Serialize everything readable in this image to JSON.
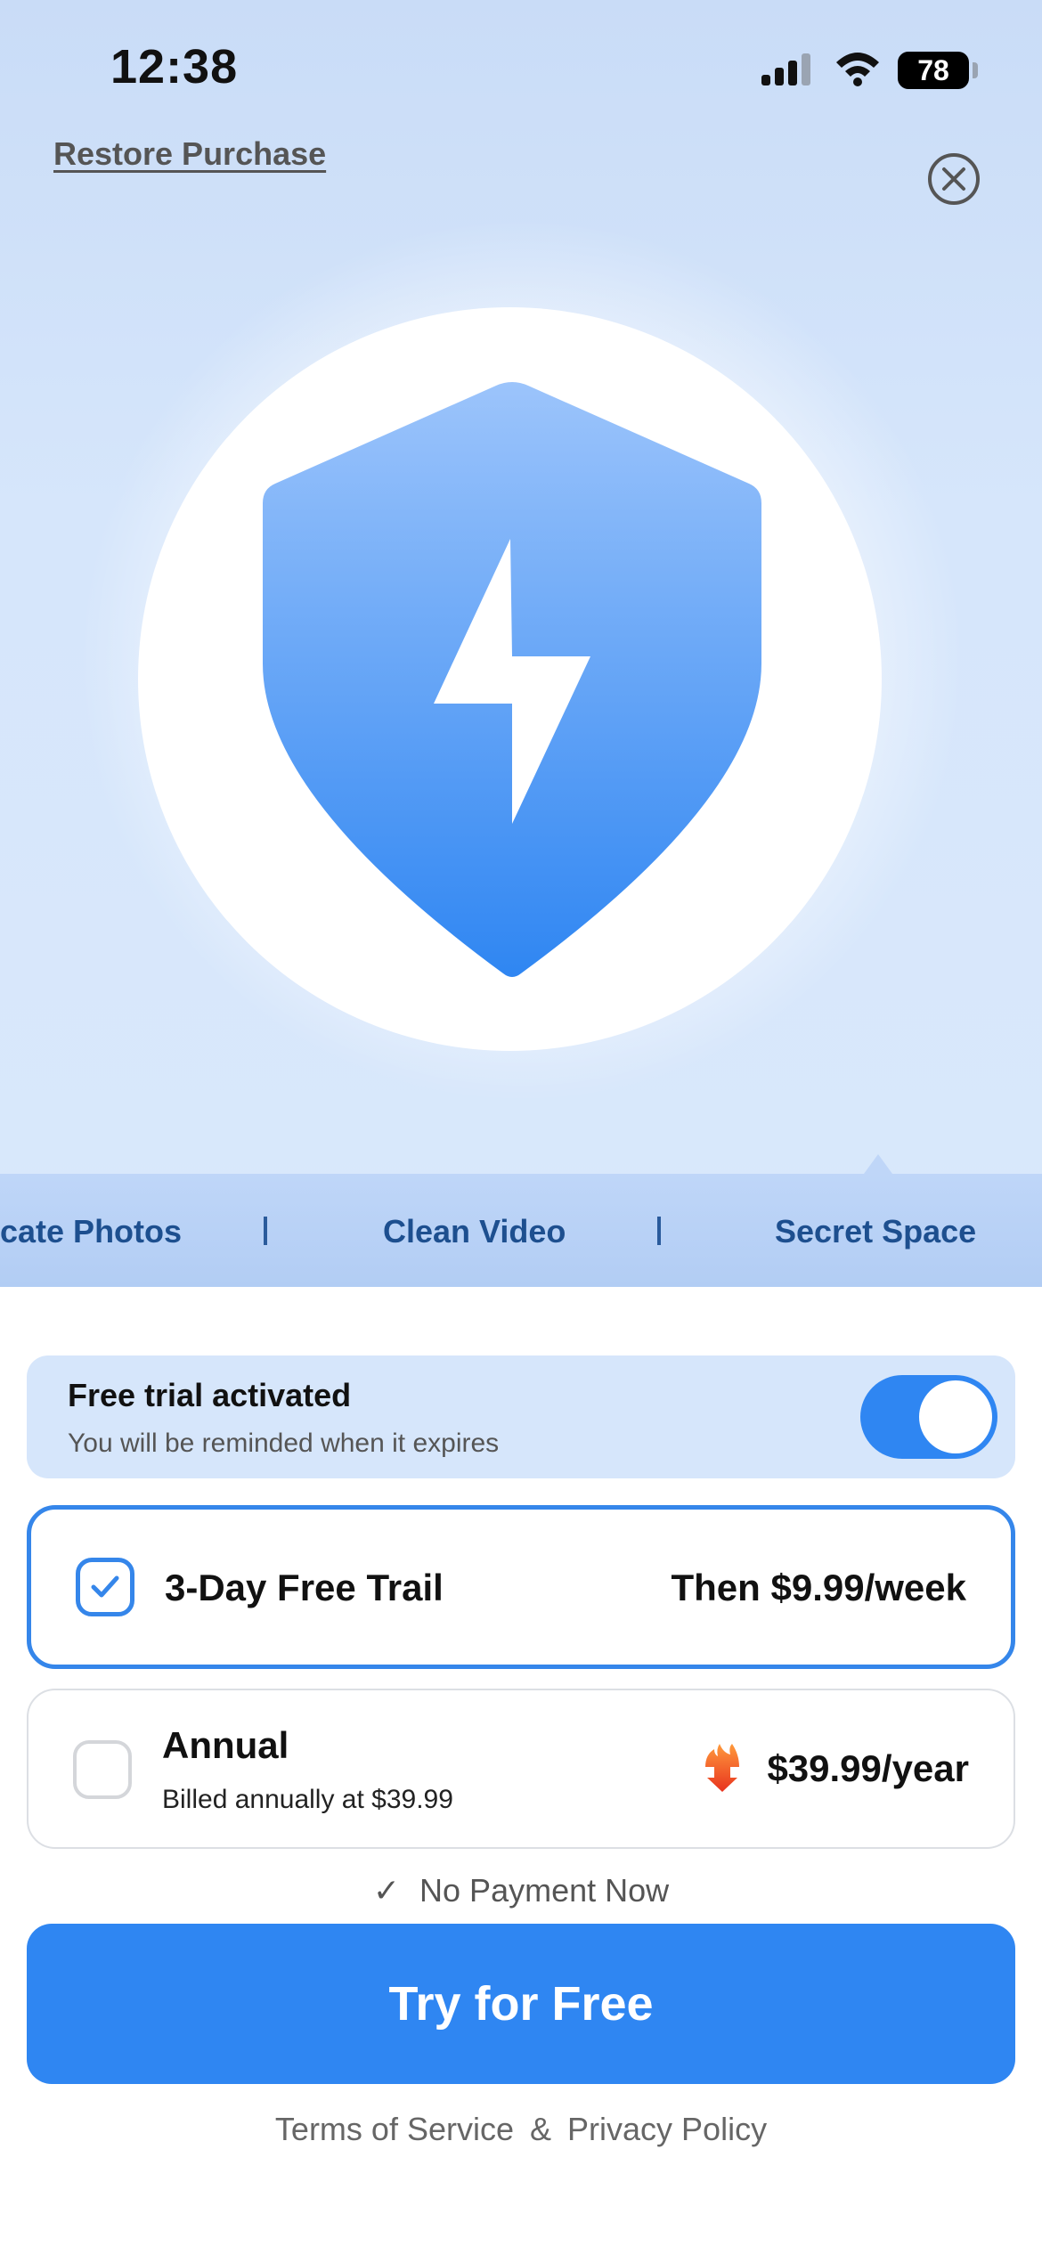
{
  "status_bar": {
    "time": "12:38",
    "battery": "78"
  },
  "header": {
    "restore_label": "Restore Purchase"
  },
  "feature_tabs": [
    "cate Photos",
    "Clean Video",
    "Secret Space"
  ],
  "trial": {
    "title": "Free trial activated",
    "subtitle": "You will be reminded when it expires",
    "enabled": true
  },
  "plans": [
    {
      "name": "3-Day Free Trail",
      "price": "Then $9.99/week",
      "selected": true
    },
    {
      "name": "Annual",
      "subtitle": "Billed annually at $39.99",
      "price": "$39.99/year",
      "selected": false
    }
  ],
  "no_payment": {
    "check": "✓",
    "text": "No Payment Now"
  },
  "cta_label": "Try for Free",
  "footer": {
    "terms": "Terms of Service",
    "amp": "&",
    "privacy": "Privacy Policy"
  },
  "colors": {
    "accent": "#2f86f2",
    "hero_bg": "#d6e6fb",
    "tab_text": "#1d4f8f"
  },
  "icons": {
    "close": "close-circle-icon",
    "hero": "shield-lightning-icon",
    "hot": "fire-icon",
    "check": "checkmark-icon"
  }
}
